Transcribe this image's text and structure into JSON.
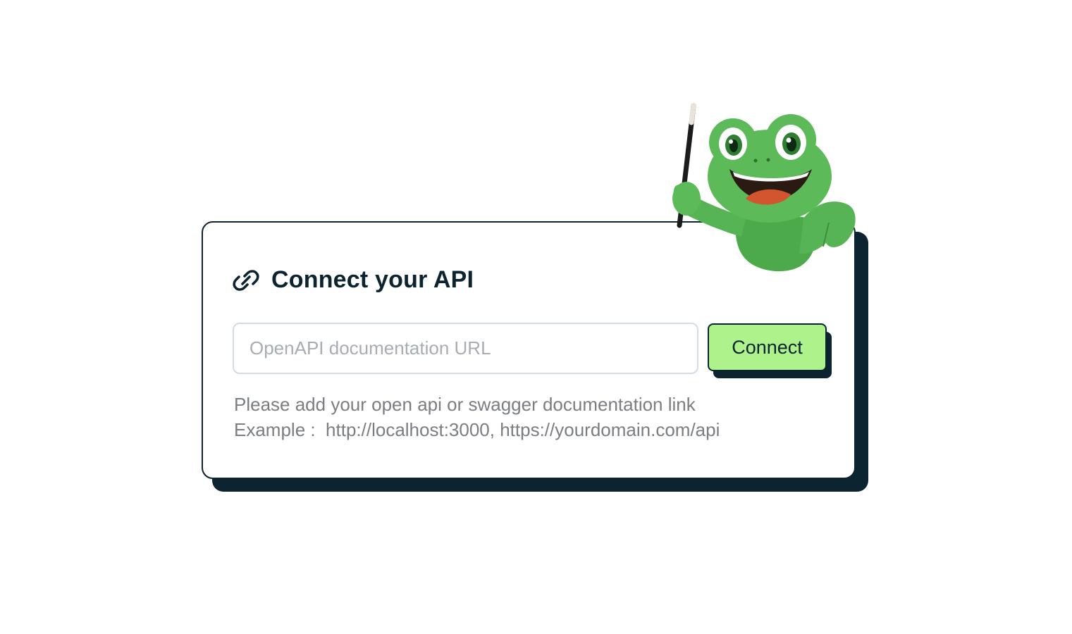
{
  "card": {
    "title": "Connect your API",
    "link_icon": "link-icon"
  },
  "form": {
    "url_placeholder": "OpenAPI documentation URL",
    "url_value": "",
    "connect_label": "Connect"
  },
  "help": {
    "line1": "Please add your open api or swagger documentation link",
    "line2": "Example :  http://localhost:3000, https://yourdomain.com/api"
  },
  "mascot": {
    "icon": "frog-mascot-with-wand"
  },
  "colors": {
    "ink": "#0c2330",
    "button_bg": "#aef28c",
    "muted_text": "#7a7e82",
    "input_border": "#d3dce4",
    "frog_green": "#4caf50"
  }
}
